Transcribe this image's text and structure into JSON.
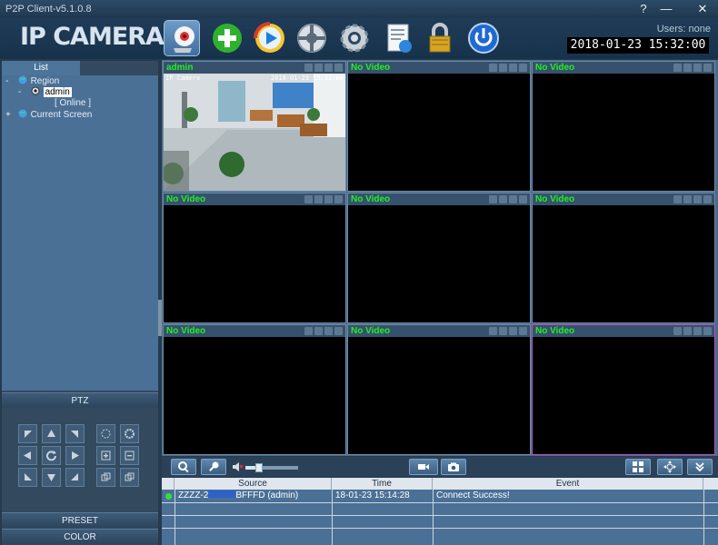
{
  "window": {
    "title": "P2P Client-v5.1.0.8",
    "help_label": "?",
    "minimize_label": "—",
    "close_label": "✕"
  },
  "header": {
    "logo": "IP CAMERA",
    "users": "Users: none",
    "datetime": "2018-01-23  15:32:00",
    "tools": [
      "camera-icon",
      "add-device-icon",
      "playback-icon",
      "ptz-wheel-icon",
      "settings-gear-icon",
      "log-document-icon",
      "lock-icon",
      "power-icon"
    ]
  },
  "sidebar": {
    "tab_label": "List",
    "tree": {
      "region": "Region",
      "device": "admin",
      "status": "[   Online   ]",
      "current_screen": "Current Screen",
      "expand_minus": "-",
      "expand_plus": "+"
    },
    "ptz_label": "PTZ",
    "preset_label": "PRESET",
    "color_label": "COLOR"
  },
  "video": {
    "cells": [
      {
        "label": "admin",
        "has_feed": true,
        "feed_overlay": "IP Camera",
        "feed_time": "2018-01-23 15:32:00"
      },
      {
        "label": "No Video"
      },
      {
        "label": "No Video"
      },
      {
        "label": "No Video"
      },
      {
        "label": "No Video"
      },
      {
        "label": "No Video"
      },
      {
        "label": "No Video"
      },
      {
        "label": "No Video"
      },
      {
        "label": "No Video",
        "active": true
      }
    ]
  },
  "toolbar": {
    "volume_level": 0.25,
    "icons": [
      "zoom-icon",
      "microphone-icon",
      "speaker-icon",
      "record-icon",
      "snapshot-icon",
      "layout-grid-icon",
      "fullscreen-icon",
      "collapse-icon"
    ]
  },
  "events": {
    "columns": [
      "Source",
      "Time",
      "Event"
    ],
    "rows": [
      {
        "source": "ZZZZ-2",
        "source_suffix": "BFFFD (admin)",
        "time": "18-01-23 15:14:28",
        "event": "Connect Success!"
      }
    ]
  },
  "colors": {
    "accent_green": "#22ef22",
    "active_border": "#c24fc2",
    "panel_blue": "#4b7096"
  }
}
